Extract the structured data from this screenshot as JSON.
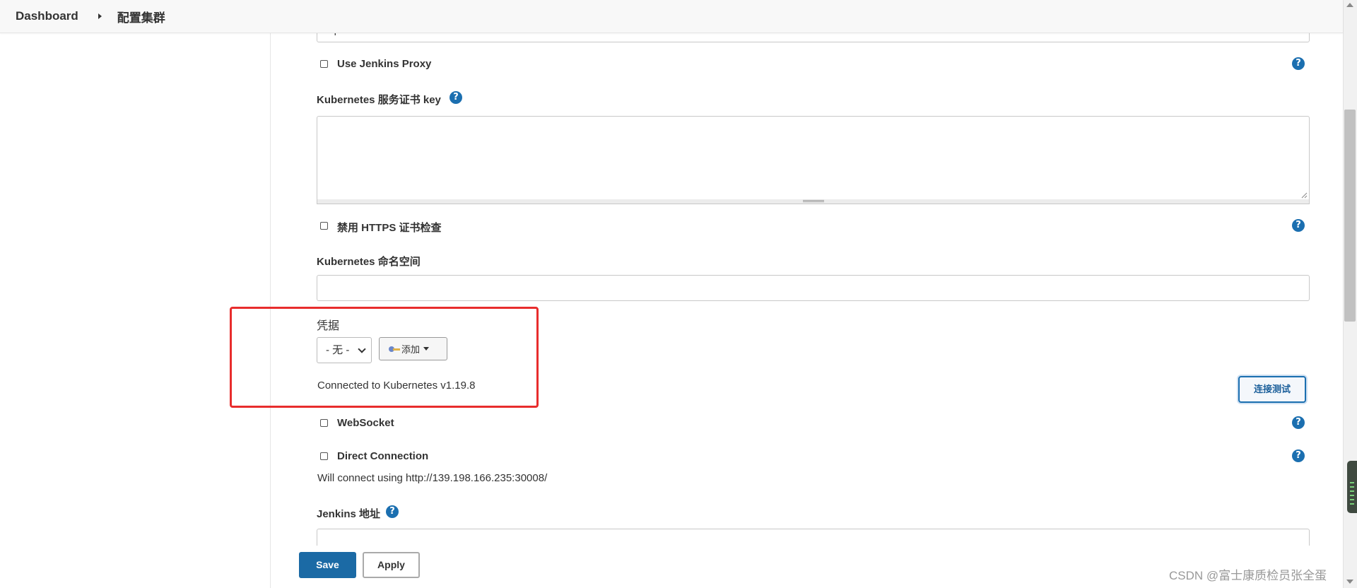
{
  "breadcrumb": {
    "home": "Dashboard",
    "current": "配置集群"
  },
  "fields": {
    "server_url_value": "https://kubernetes.default",
    "use_jenkins_proxy": "Use Jenkins Proxy",
    "server_cert_key_label": "Kubernetes 服务证书 key",
    "disable_https_check": "禁用 HTTPS 证书检查",
    "namespace_label": "Kubernetes 命名空间",
    "credentials_label": "凭据",
    "credentials_selected": "- 无 -",
    "add_button": "添加",
    "connection_status": "Connected to Kubernetes v1.19.8",
    "test_connection_button": "连接测试",
    "websocket": "WebSocket",
    "direct_connection": "Direct Connection",
    "direct_connection_note": "Will connect using http://139.198.166.235:30008/",
    "jenkins_url_label": "Jenkins 地址"
  },
  "help_glyph": "?",
  "buttons": {
    "save": "Save",
    "apply": "Apply"
  },
  "watermark": "CSDN @富士康质检员张全蛋",
  "colors": {
    "accent": "#1b6aa5",
    "highlight_box": "#e82d2d"
  }
}
